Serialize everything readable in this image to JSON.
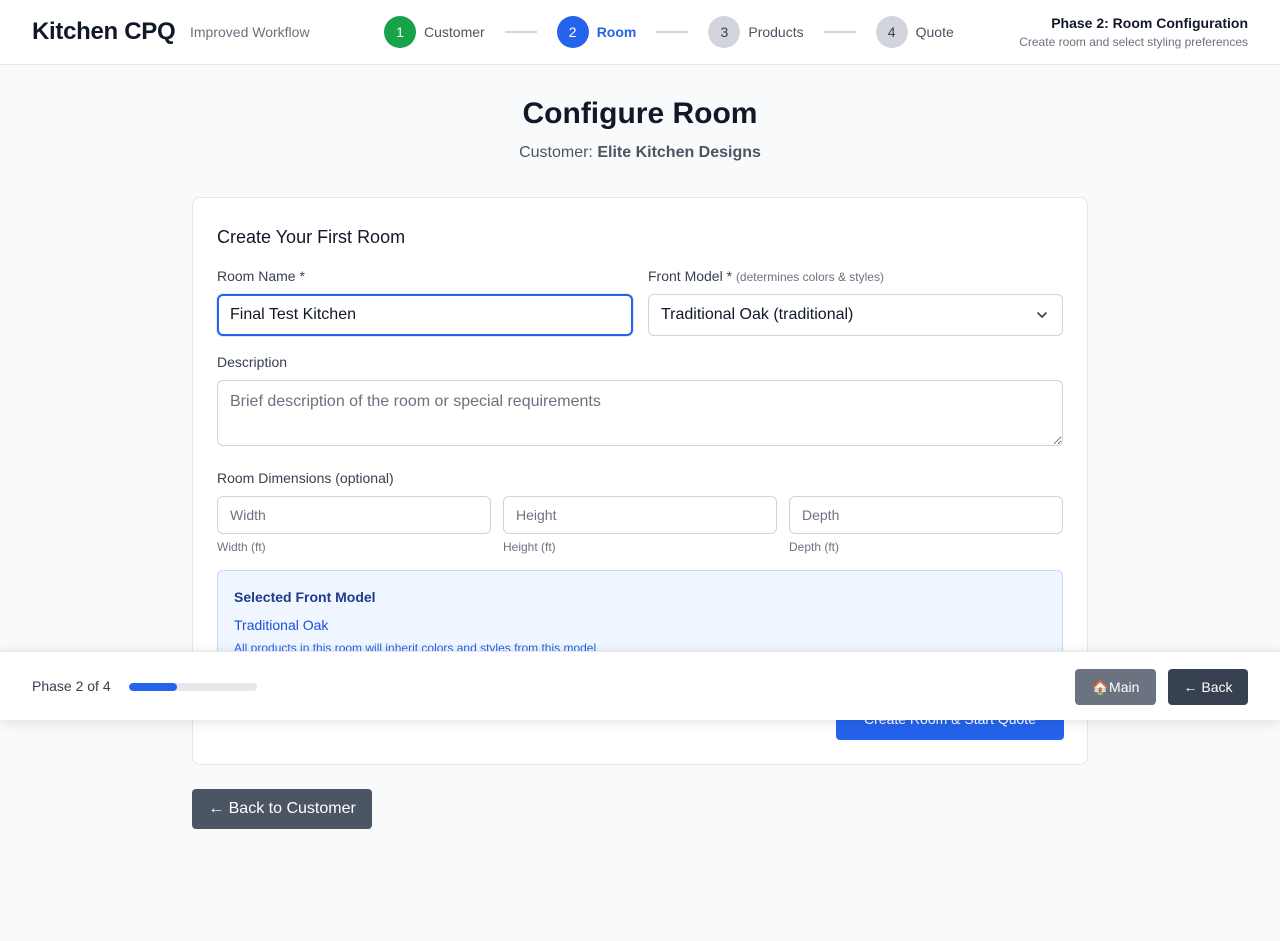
{
  "header": {
    "brand": "Kitchen CPQ",
    "subtitle": "Improved Workflow",
    "steps": [
      {
        "number": "1",
        "label": "Customer",
        "state": "done"
      },
      {
        "number": "2",
        "label": "Room",
        "state": "active"
      },
      {
        "number": "3",
        "label": "Products",
        "state": "todo"
      },
      {
        "number": "4",
        "label": "Quote",
        "state": "todo"
      }
    ],
    "phase_title": "Phase 2: Room Configuration",
    "phase_desc": "Create room and select styling preferences"
  },
  "page": {
    "title": "Configure Room",
    "customer_label": "Customer:",
    "customer_name": "Elite Kitchen Designs"
  },
  "form": {
    "card_title": "Create Your First Room",
    "room_name_label": "Room Name *",
    "room_name_value": "Final Test Kitchen",
    "front_model_label": "Front Model *",
    "front_model_hint": "(determines colors & styles)",
    "front_model_value": "Traditional Oak (traditional)",
    "description_label": "Description",
    "description_placeholder": "Brief description of the room or special requirements",
    "dimensions_label": "Room Dimensions (optional)",
    "width_placeholder": "Width",
    "height_placeholder": "Height",
    "depth_placeholder": "Depth",
    "width_hint": "Width (ft)",
    "height_hint": "Height (ft)",
    "depth_hint": "Depth (ft)",
    "selected_heading": "Selected Front Model",
    "selected_model": "Traditional Oak",
    "selected_note": "All products in this room will inherit colors and styles from this model",
    "submit_label": "Create Room & Start Quote"
  },
  "back_to_customer_label": "← Back to Customer",
  "footer": {
    "phase_count": "Phase 2 of 4",
    "progress_percent": 37.5,
    "main_label": "🏠Main",
    "back_label": "← Back"
  },
  "colors": {
    "primary": "#2563eb",
    "success": "#16a34a",
    "muted": "#d1d5db"
  }
}
